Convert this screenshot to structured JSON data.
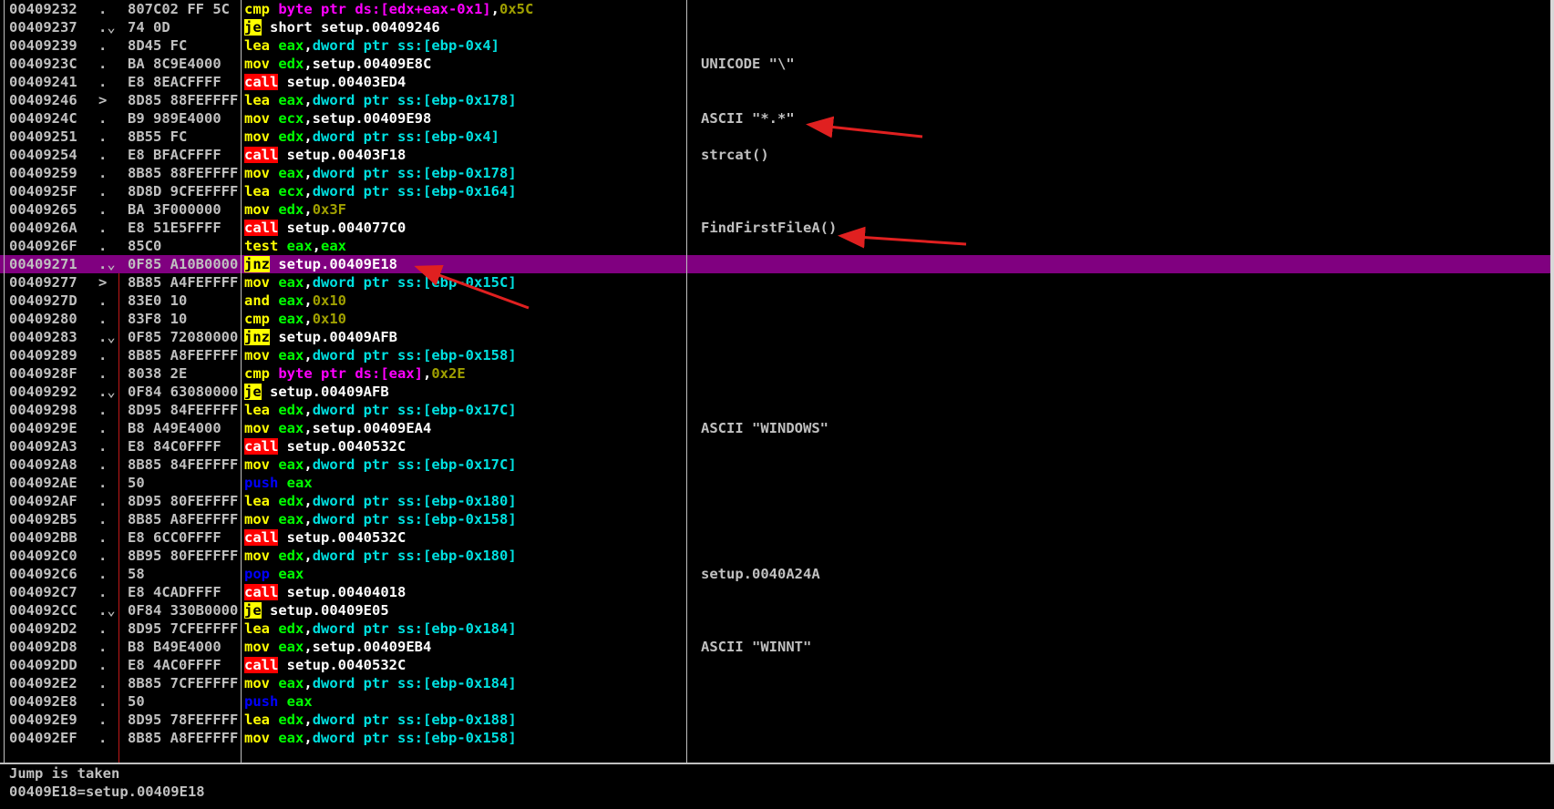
{
  "accent_colors": {
    "selected_row": "#800080",
    "call_highlight": "#ff0000",
    "jump_highlight": "#ffff00",
    "annotation_arrow": "#e02020"
  },
  "disassembly": [
    {
      "addr": "00409232",
      "mark": ".",
      "hex": "807C02 FF 5C",
      "mn": "cmp",
      "mn_class": "mn-yellow",
      "ops": [
        [
          "byte ptr ds:[edx+eax-0x1]",
          "op-magenta"
        ],
        [
          ",",
          ""
        ],
        [
          "0x5C",
          "op-olive"
        ]
      ],
      "comment": ""
    },
    {
      "addr": "00409237",
      "mark": ".⌄",
      "hex": "74 0D",
      "mn": "je",
      "mn_class": "mn-yellowbg",
      "ops": [
        [
          "short setup.00409246",
          ""
        ]
      ],
      "comment": ""
    },
    {
      "addr": "00409239",
      "mark": ".",
      "hex": "8D45 FC",
      "mn": "lea",
      "mn_class": "mn-yellow",
      "ops": [
        [
          "eax",
          "op-green"
        ],
        [
          ",",
          ""
        ],
        [
          "dword ptr ss:[ebp-0x4]",
          "op-cyan"
        ]
      ],
      "comment": ""
    },
    {
      "addr": "0040923C",
      "mark": ".",
      "hex": "BA 8C9E4000",
      "mn": "mov",
      "mn_class": "mn-yellow",
      "ops": [
        [
          "edx",
          "op-green"
        ],
        [
          ",setup.00409E8C",
          ""
        ]
      ],
      "comment": "UNICODE \"\\\""
    },
    {
      "addr": "00409241",
      "mark": ".",
      "hex": "E8 8EACFFFF",
      "mn": "call",
      "mn_class": "mn-red",
      "ops": [
        [
          "setup.00403ED4",
          ""
        ]
      ],
      "comment": ""
    },
    {
      "addr": "00409246",
      "mark": ">",
      "hex": "8D85 88FEFFFF",
      "mn": "lea",
      "mn_class": "mn-yellow",
      "ops": [
        [
          "eax",
          "op-green"
        ],
        [
          ",",
          ""
        ],
        [
          "dword ptr ss:[ebp-0x178]",
          "op-cyan"
        ]
      ],
      "comment": ""
    },
    {
      "addr": "0040924C",
      "mark": ".",
      "hex": "B9 989E4000",
      "mn": "mov",
      "mn_class": "mn-yellow",
      "ops": [
        [
          "ecx",
          "op-green"
        ],
        [
          ",setup.00409E98",
          ""
        ]
      ],
      "comment": "ASCII \"*.*\""
    },
    {
      "addr": "00409251",
      "mark": ".",
      "hex": "8B55 FC",
      "mn": "mov",
      "mn_class": "mn-yellow",
      "ops": [
        [
          "edx",
          "op-green"
        ],
        [
          ",",
          ""
        ],
        [
          "dword ptr ss:[ebp-0x4]",
          "op-cyan"
        ]
      ],
      "comment": ""
    },
    {
      "addr": "00409254",
      "mark": ".",
      "hex": "E8 BFACFFFF",
      "mn": "call",
      "mn_class": "mn-red",
      "ops": [
        [
          "setup.00403F18",
          ""
        ]
      ],
      "comment": "strcat()"
    },
    {
      "addr": "00409259",
      "mark": ".",
      "hex": "8B85 88FEFFFF",
      "mn": "mov",
      "mn_class": "mn-yellow",
      "ops": [
        [
          "eax",
          "op-green"
        ],
        [
          ",",
          ""
        ],
        [
          "dword ptr ss:[ebp-0x178]",
          "op-cyan"
        ]
      ],
      "comment": ""
    },
    {
      "addr": "0040925F",
      "mark": ".",
      "hex": "8D8D 9CFEFFFF",
      "mn": "lea",
      "mn_class": "mn-yellow",
      "ops": [
        [
          "ecx",
          "op-green"
        ],
        [
          ",",
          ""
        ],
        [
          "dword ptr ss:[ebp-0x164]",
          "op-cyan"
        ]
      ],
      "comment": ""
    },
    {
      "addr": "00409265",
      "mark": ".",
      "hex": "BA 3F000000",
      "mn": "mov",
      "mn_class": "mn-yellow",
      "ops": [
        [
          "edx",
          "op-green"
        ],
        [
          ",",
          ""
        ],
        [
          "0x3F",
          "op-olive"
        ]
      ],
      "comment": ""
    },
    {
      "addr": "0040926A",
      "mark": ".",
      "hex": "E8 51E5FFFF",
      "mn": "call",
      "mn_class": "mn-red",
      "ops": [
        [
          "setup.004077C0",
          ""
        ]
      ],
      "comment": "FindFirstFileA()"
    },
    {
      "addr": "0040926F",
      "mark": ".",
      "hex": "85C0",
      "mn": "test",
      "mn_class": "mn-yellow",
      "ops": [
        [
          "eax",
          "op-green"
        ],
        [
          ",",
          ""
        ],
        [
          "eax",
          "op-green"
        ]
      ],
      "comment": ""
    },
    {
      "addr": "00409271",
      "mark": ".⌄",
      "hex": "0F85 A10B0000",
      "mn": "jnz",
      "mn_class": "mn-yellowbg",
      "ops": [
        [
          "setup.00409E18",
          ""
        ]
      ],
      "comment": "",
      "selected": true
    },
    {
      "addr": "00409277",
      "mark": ">",
      "hex": "8B85 A4FEFFFF",
      "mn": "mov",
      "mn_class": "mn-yellow",
      "ops": [
        [
          "eax",
          "op-green"
        ],
        [
          ",",
          ""
        ],
        [
          "dword ptr ss:[ebp-0x15C]",
          "op-cyan"
        ]
      ],
      "comment": ""
    },
    {
      "addr": "0040927D",
      "mark": ".",
      "hex": "83E0 10",
      "mn": "and",
      "mn_class": "mn-yellow",
      "ops": [
        [
          "eax",
          "op-green"
        ],
        [
          ",",
          ""
        ],
        [
          "0x10",
          "op-olive"
        ]
      ],
      "comment": ""
    },
    {
      "addr": "00409280",
      "mark": ".",
      "hex": "83F8 10",
      "mn": "cmp",
      "mn_class": "mn-yellow",
      "ops": [
        [
          "eax",
          "op-green"
        ],
        [
          ",",
          ""
        ],
        [
          "0x10",
          "op-olive"
        ]
      ],
      "comment": ""
    },
    {
      "addr": "00409283",
      "mark": ".⌄",
      "hex": "0F85 72080000",
      "mn": "jnz",
      "mn_class": "mn-yellowbg",
      "ops": [
        [
          "setup.00409AFB",
          ""
        ]
      ],
      "comment": ""
    },
    {
      "addr": "00409289",
      "mark": ".",
      "hex": "8B85 A8FEFFFF",
      "mn": "mov",
      "mn_class": "mn-yellow",
      "ops": [
        [
          "eax",
          "op-green"
        ],
        [
          ",",
          ""
        ],
        [
          "dword ptr ss:[ebp-0x158]",
          "op-cyan"
        ]
      ],
      "comment": ""
    },
    {
      "addr": "0040928F",
      "mark": ".",
      "hex": "8038 2E",
      "mn": "cmp",
      "mn_class": "mn-yellow",
      "ops": [
        [
          "byte ptr ds:[eax]",
          "op-magenta"
        ],
        [
          ",",
          ""
        ],
        [
          "0x2E",
          "op-olive"
        ]
      ],
      "comment": ""
    },
    {
      "addr": "00409292",
      "mark": ".⌄",
      "hex": "0F84 63080000",
      "mn": "je",
      "mn_class": "mn-yellowbg",
      "ops": [
        [
          "setup.00409AFB",
          ""
        ]
      ],
      "comment": ""
    },
    {
      "addr": "00409298",
      "mark": ".",
      "hex": "8D95 84FEFFFF",
      "mn": "lea",
      "mn_class": "mn-yellow",
      "ops": [
        [
          "edx",
          "op-green"
        ],
        [
          ",",
          ""
        ],
        [
          "dword ptr ss:[ebp-0x17C]",
          "op-cyan"
        ]
      ],
      "comment": ""
    },
    {
      "addr": "0040929E",
      "mark": ".",
      "hex": "B8 A49E4000",
      "mn": "mov",
      "mn_class": "mn-yellow",
      "ops": [
        [
          "eax",
          "op-green"
        ],
        [
          ",setup.00409EA4",
          ""
        ]
      ],
      "comment": "ASCII \"WINDOWS\""
    },
    {
      "addr": "004092A3",
      "mark": ".",
      "hex": "E8 84C0FFFF",
      "mn": "call",
      "mn_class": "mn-red",
      "ops": [
        [
          "setup.0040532C",
          ""
        ]
      ],
      "comment": ""
    },
    {
      "addr": "004092A8",
      "mark": ".",
      "hex": "8B85 84FEFFFF",
      "mn": "mov",
      "mn_class": "mn-yellow",
      "ops": [
        [
          "eax",
          "op-green"
        ],
        [
          ",",
          ""
        ],
        [
          "dword ptr ss:[ebp-0x17C]",
          "op-cyan"
        ]
      ],
      "comment": ""
    },
    {
      "addr": "004092AE",
      "mark": ".",
      "hex": "50",
      "mn": "push",
      "mn_class": "mn-blue",
      "ops": [
        [
          "eax",
          "op-green"
        ]
      ],
      "comment": ""
    },
    {
      "addr": "004092AF",
      "mark": ".",
      "hex": "8D95 80FEFFFF",
      "mn": "lea",
      "mn_class": "mn-yellow",
      "ops": [
        [
          "edx",
          "op-green"
        ],
        [
          ",",
          ""
        ],
        [
          "dword ptr ss:[ebp-0x180]",
          "op-cyan"
        ]
      ],
      "comment": ""
    },
    {
      "addr": "004092B5",
      "mark": ".",
      "hex": "8B85 A8FEFFFF",
      "mn": "mov",
      "mn_class": "mn-yellow",
      "ops": [
        [
          "eax",
          "op-green"
        ],
        [
          ",",
          ""
        ],
        [
          "dword ptr ss:[ebp-0x158]",
          "op-cyan"
        ]
      ],
      "comment": ""
    },
    {
      "addr": "004092BB",
      "mark": ".",
      "hex": "E8 6CC0FFFF",
      "mn": "call",
      "mn_class": "mn-red",
      "ops": [
        [
          "setup.0040532C",
          ""
        ]
      ],
      "comment": ""
    },
    {
      "addr": "004092C0",
      "mark": ".",
      "hex": "8B95 80FEFFFF",
      "mn": "mov",
      "mn_class": "mn-yellow",
      "ops": [
        [
          "edx",
          "op-green"
        ],
        [
          ",",
          ""
        ],
        [
          "dword ptr ss:[ebp-0x180]",
          "op-cyan"
        ]
      ],
      "comment": ""
    },
    {
      "addr": "004092C6",
      "mark": ".",
      "hex": "58",
      "mn": "pop",
      "mn_class": "mn-blue",
      "ops": [
        [
          "eax",
          "op-green"
        ]
      ],
      "comment": "setup.0040A24A"
    },
    {
      "addr": "004092C7",
      "mark": ".",
      "hex": "E8 4CADFFFF",
      "mn": "call",
      "mn_class": "mn-red",
      "ops": [
        [
          "setup.00404018",
          ""
        ]
      ],
      "comment": ""
    },
    {
      "addr": "004092CC",
      "mark": ".⌄",
      "hex": "0F84 330B0000",
      "mn": "je",
      "mn_class": "mn-yellowbg",
      "ops": [
        [
          "setup.00409E05",
          ""
        ]
      ],
      "comment": ""
    },
    {
      "addr": "004092D2",
      "mark": ".",
      "hex": "8D95 7CFEFFFF",
      "mn": "lea",
      "mn_class": "mn-yellow",
      "ops": [
        [
          "edx",
          "op-green"
        ],
        [
          ",",
          ""
        ],
        [
          "dword ptr ss:[ebp-0x184]",
          "op-cyan"
        ]
      ],
      "comment": ""
    },
    {
      "addr": "004092D8",
      "mark": ".",
      "hex": "B8 B49E4000",
      "mn": "mov",
      "mn_class": "mn-yellow",
      "ops": [
        [
          "eax",
          "op-green"
        ],
        [
          ",setup.00409EB4",
          ""
        ]
      ],
      "comment": "ASCII \"WINNT\""
    },
    {
      "addr": "004092DD",
      "mark": ".",
      "hex": "E8 4AC0FFFF",
      "mn": "call",
      "mn_class": "mn-red",
      "ops": [
        [
          "setup.0040532C",
          ""
        ]
      ],
      "comment": ""
    },
    {
      "addr": "004092E2",
      "mark": ".",
      "hex": "8B85 7CFEFFFF",
      "mn": "mov",
      "mn_class": "mn-yellow",
      "ops": [
        [
          "eax",
          "op-green"
        ],
        [
          ",",
          ""
        ],
        [
          "dword ptr ss:[ebp-0x184]",
          "op-cyan"
        ]
      ],
      "comment": ""
    },
    {
      "addr": "004092E8",
      "mark": ".",
      "hex": "50",
      "mn": "push",
      "mn_class": "mn-blue",
      "ops": [
        [
          "eax",
          "op-green"
        ]
      ],
      "comment": ""
    },
    {
      "addr": "004092E9",
      "mark": ".",
      "hex": "8D95 78FEFFFF",
      "mn": "lea",
      "mn_class": "mn-yellow",
      "ops": [
        [
          "edx",
          "op-green"
        ],
        [
          ",",
          ""
        ],
        [
          "dword ptr ss:[ebp-0x188]",
          "op-cyan"
        ]
      ],
      "comment": ""
    },
    {
      "addr": "004092EF",
      "mark": ".",
      "hex": "8B85 A8FEFFFF",
      "mn": "mov",
      "mn_class": "mn-yellow",
      "ops": [
        [
          "eax",
          "op-green"
        ],
        [
          ",",
          ""
        ],
        [
          "dword ptr ss:[ebp-0x158]",
          "op-cyan"
        ]
      ],
      "comment": ""
    }
  ],
  "info": {
    "line1": "Jump is taken",
    "line2": "00409E18=setup.00409E18"
  }
}
